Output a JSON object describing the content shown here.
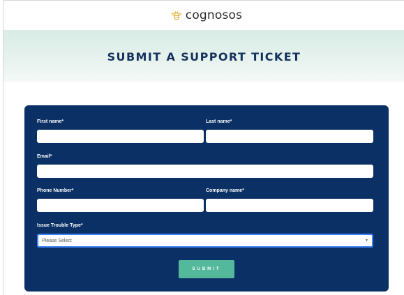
{
  "header": {
    "brand": "cognosos"
  },
  "banner": {
    "title": "SUBMIT A SUPPORT TICKET"
  },
  "form": {
    "first_name_label": "First name*",
    "last_name_label": "Last name*",
    "email_label": "Email*",
    "phone_label": "Phone Number*",
    "company_label": "Company name*",
    "issue_type_label": "Issue Trouble Type*",
    "issue_type_value": "Please Select",
    "submit_label": "SUBMIT"
  },
  "colors": {
    "form_background": "#0a3066",
    "title_color": "#13315c",
    "submit_background": "#54b89a",
    "logo_accent": "#e3b23c"
  }
}
